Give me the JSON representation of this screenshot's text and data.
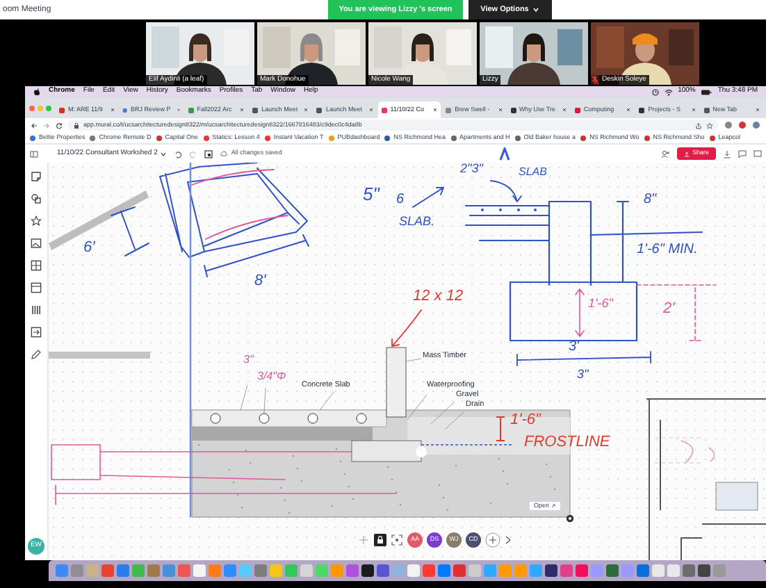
{
  "zoom_window": {
    "title": "oom Meeting",
    "banner": "You are viewing Lizzy 's screen",
    "view_options": "View Options"
  },
  "participants": [
    {
      "name": "Elif Aydinli (a leaf)",
      "muted": false
    },
    {
      "name": "Mark Donohue",
      "muted": false
    },
    {
      "name": "Nicole Wang",
      "muted": false
    },
    {
      "name": "Lizzy",
      "muted": false
    },
    {
      "name": "Deskin Soleye",
      "muted": true
    }
  ],
  "menu_bar": {
    "app": "Chrome",
    "items": [
      "File",
      "Edit",
      "View",
      "History",
      "Bookmarks",
      "Profiles",
      "Tab",
      "Window",
      "Help"
    ],
    "battery": "100%",
    "clock": "Thu 3:48 PM"
  },
  "tabs": [
    {
      "label": "M: ARE 11/9",
      "selected": false
    },
    {
      "label": "BRJ Review P",
      "selected": false
    },
    {
      "label": "Fall2022 Arc",
      "selected": false
    },
    {
      "label": "Launch Meet",
      "selected": false
    },
    {
      "label": "Launch Meet",
      "selected": false
    },
    {
      "label": "11/10/22 Co",
      "selected": true
    },
    {
      "label": "Brew Swell -",
      "selected": false
    },
    {
      "label": "Why Use Tre",
      "selected": false
    },
    {
      "label": "Computing",
      "selected": false
    },
    {
      "label": "Projects - S",
      "selected": false
    },
    {
      "label": "New Tab",
      "selected": false
    }
  ],
  "address": "app.mural.co/t/ucsarchitecturedesign8322/m/ucsarchitecturedesign8322/1667816483/c9dec0c4da8b",
  "bookmarks": [
    "Bettie Properties",
    "Chrome Remote D",
    "Capital One",
    "Statics: Lesson 4",
    "Instant Vacation T",
    "PUBdashboard",
    "NS Richmond Hea",
    "Apartments and H",
    "Old Baker house a",
    "NS Richmond Wo",
    "NS Richmond Sho",
    "Leapcol"
  ],
  "board": {
    "title": "11/10/22 Consultant Workshed 2",
    "save_status": "All changes saved",
    "share": "Share"
  },
  "annotations": [
    {
      "text": "6'",
      "color": "#2f52c8"
    },
    {
      "text": "8'",
      "color": "#2f52c8"
    },
    {
      "text": "5\"",
      "color": "#2f52c8"
    },
    {
      "text": "6",
      "color": "#2f52c8"
    },
    {
      "text": "SLAB.",
      "color": "#2f52c8"
    },
    {
      "text": "2\"3\"",
      "color": "#2f52c8"
    },
    {
      "text": "SLAB",
      "color": "#2f52c8"
    },
    {
      "text": "8\"",
      "color": "#2f52c8"
    },
    {
      "text": "1'-6\" MIN.",
      "color": "#2f52c8"
    },
    {
      "text": "2'",
      "color": "#e0579b"
    },
    {
      "text": "1'-6\"",
      "color": "#e0579b"
    },
    {
      "text": "12 x 12",
      "color": "#e5392f"
    },
    {
      "text": "3'",
      "color": "#2f52c8"
    },
    {
      "text": "3\"",
      "color": "#2f52c8"
    },
    {
      "text": "3\"",
      "color": "#e0579b"
    },
    {
      "text": "3/4\"Φ",
      "color": "#e0579b"
    },
    {
      "text": "1'-6\"",
      "color": "#e5392f"
    },
    {
      "text": "FROSTLINE",
      "color": "#e5392f"
    }
  ],
  "detail_labels": [
    "Mass Timber",
    "Concrete Slab",
    "Waterproofing",
    "Gravel",
    "Drain"
  ],
  "open_button": "Open",
  "collaborators": [
    {
      "initials": "AA",
      "color": "#e05a6a"
    },
    {
      "initials": "DS",
      "color": "#7a3bd6"
    },
    {
      "initials": "WJ",
      "color": "#8b7b6b"
    },
    {
      "initials": "CD",
      "color": "#4b5070"
    }
  ],
  "me": {
    "initials": "EW",
    "color": "#3bb3a4"
  }
}
